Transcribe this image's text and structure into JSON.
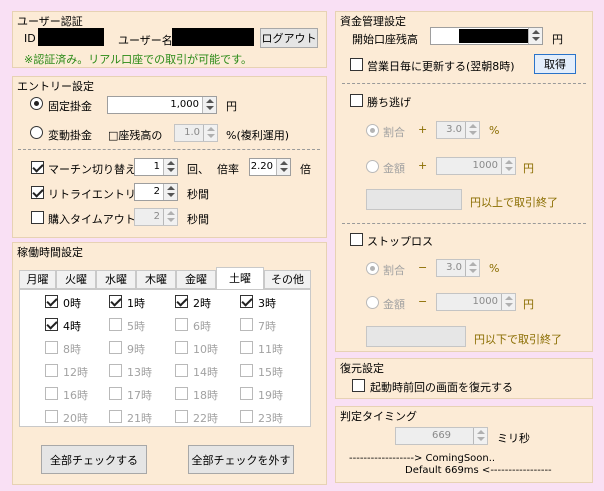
{
  "user_auth": {
    "title": "ユーザー認証",
    "id_label": "ID",
    "username_label": "ユーザー名",
    "logout_label": "ログアウト",
    "status_message": "※認証済み。リアル口座での取引が可能です。"
  },
  "entry": {
    "title": "エントリー設定",
    "fixed_label": "固定掛金",
    "fixed_value": "1,000",
    "yen": "円",
    "variable_label": "変動掛金",
    "balance_ratio_label": "□座残高の",
    "balance_ratio_value": "1.0",
    "percent_compound": "%(複利運用)",
    "martingale_label": "マーチン切り替え",
    "martingale_times": "1",
    "times_unit": "回、",
    "multiplier_label": "倍率",
    "multiplier_value": "2.20",
    "multiplier_unit": "倍",
    "retry_label": "リトライエントリー",
    "retry_value": "2",
    "seconds_unit": "秒間",
    "timeout_label": "購入タイムアウト",
    "timeout_value": "2",
    "timeout_unit": "秒間"
  },
  "schedule": {
    "title": "稼働時間設定",
    "tabs": [
      "月曜",
      "火曜",
      "水曜",
      "木曜",
      "金曜",
      "土曜",
      "その他"
    ],
    "active_tab": 5,
    "hours": [
      "0時",
      "1時",
      "2時",
      "3時",
      "4時",
      "5時",
      "6時",
      "7時",
      "8時",
      "9時",
      "10時",
      "11時",
      "12時",
      "13時",
      "14時",
      "15時",
      "16時",
      "17時",
      "18時",
      "19時",
      "20時",
      "21時",
      "22時",
      "23時"
    ],
    "checked_hours": [
      0,
      1,
      2,
      3,
      4
    ],
    "enabled_hours": [
      0,
      1,
      2,
      3,
      4
    ],
    "check_all_label": "全部チェックする",
    "uncheck_all_label": "全部チェックを外す"
  },
  "money": {
    "title": "資金管理設定",
    "start_balance_label": "開始口座残高",
    "yen": "円",
    "update_daily_label": "営業日毎に更新する(翌朝8時)",
    "get_button_label": "取得",
    "win_stop_label": "勝ち逃げ",
    "ratio_label": "割合",
    "amount_label": "金額",
    "plus": "+",
    "minus": "−",
    "win_ratio_value": "3.0",
    "percent": "%",
    "win_amount_value": "1000",
    "win_end_label": "円以上で取引終了",
    "stop_loss_label": "ストップロス",
    "loss_ratio_value": "3.0",
    "loss_amount_value": "1000",
    "loss_end_label": "円以下で取引終了"
  },
  "restore": {
    "title": "復元設定",
    "restore_label": "起動時前回の画面を復元する"
  },
  "timing": {
    "title": "判定タイミング",
    "value": "669",
    "unit": "ミリ秒",
    "note_line1": "------------------> ComingSoon..",
    "note_line2": "Default 669ms <-----------------"
  },
  "colors": {
    "background": "#f9e0f4",
    "panel": "#fcebd6",
    "status_green": "#2a8a16",
    "accent_blue": "#2a73c9"
  }
}
